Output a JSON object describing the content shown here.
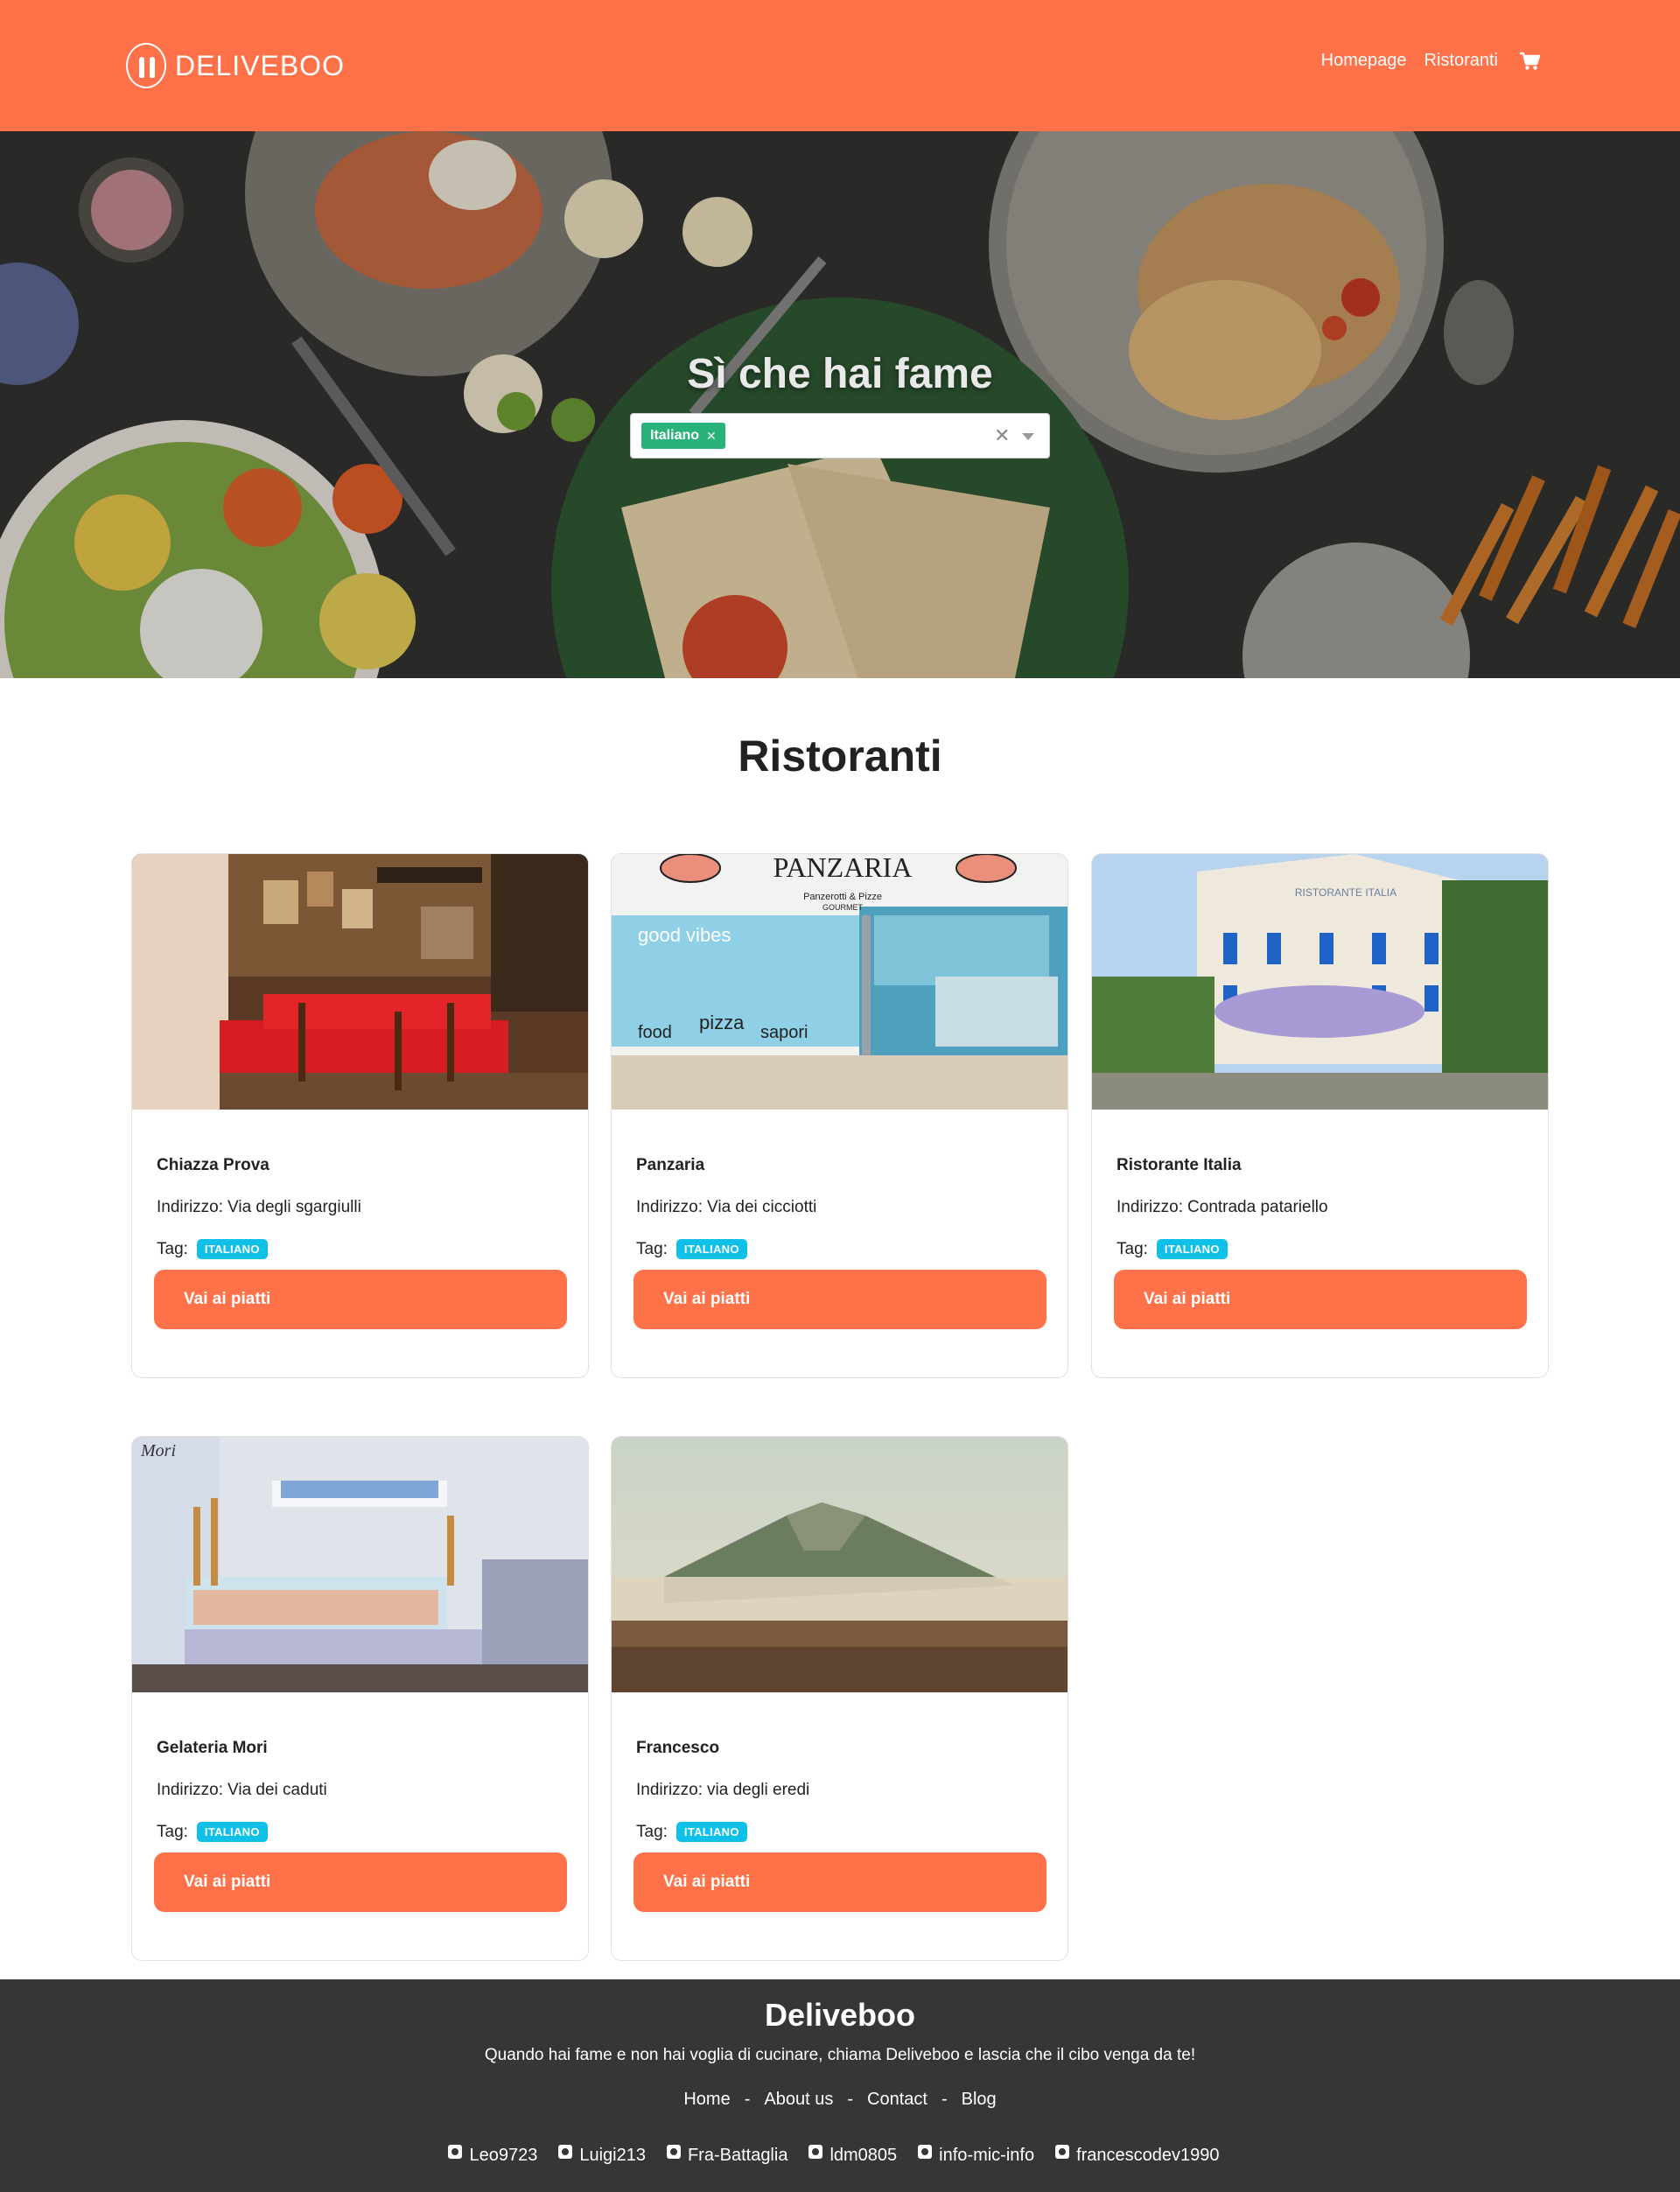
{
  "header": {
    "logo_text": "DELIVEBOO",
    "nav": [
      {
        "label": "Homepage"
      },
      {
        "label": "Ristoranti"
      }
    ]
  },
  "hero": {
    "title": "Sì che hai fame",
    "select": {
      "selected_chip": "Italiano"
    }
  },
  "section": {
    "title": "Ristoranti"
  },
  "cards": [
    {
      "name": "Chiazza Prova",
      "address_label": "Indirizzo:",
      "address": "Via degli sgargiulli",
      "tag_label": "Tag:",
      "tag": "ITALIANO",
      "button": "Vai ai piatti"
    },
    {
      "name": "Panzaria",
      "address_label": "Indirizzo:",
      "address": "Via dei cicciotti",
      "tag_label": "Tag:",
      "tag": "ITALIANO",
      "button": "Vai ai piatti"
    },
    {
      "name": "Ristorante Italia",
      "address_label": "Indirizzo:",
      "address": "Contrada patariello",
      "tag_label": "Tag:",
      "tag": "ITALIANO",
      "button": "Vai ai piatti"
    },
    {
      "name": "Gelateria Mori",
      "address_label": "Indirizzo:",
      "address": "Via dei caduti",
      "tag_label": "Tag:",
      "tag": "ITALIANO",
      "button": "Vai ai piatti"
    },
    {
      "name": "Francesco",
      "address_label": "Indirizzo:",
      "address": "via degli eredi",
      "tag_label": "Tag:",
      "tag": "ITALIANO",
      "button": "Vai ai piatti"
    }
  ],
  "card_images": {
    "panzaria_sign": "PANZARIA",
    "panzaria_sub": "Panzerotti & Pizze",
    "panzaria_gourmet": "GOURMET",
    "panzaria_words": [
      "good vibes",
      "pizza",
      "food",
      "sapori"
    ],
    "ristorante_sign": "RISTORANTE ITALIA",
    "gelateria_sign": "Mori"
  },
  "footer": {
    "title": "Deliveboo",
    "description": "Quando hai fame e non hai voglia di cucinare, chiama Deliveboo e lascia che il cibo venga da te!",
    "links": [
      "Home",
      "About us",
      "Contact",
      "Blog"
    ],
    "separator": "-",
    "users": [
      "Leo9723",
      "Luigi213",
      "Fra-Battaglia",
      "ldm0805",
      "info-mic-info",
      "francescodev1990"
    ]
  },
  "colors": {
    "brand": "#ff7149",
    "badge": "#0fc0e8",
    "chip": "#2ab27b",
    "footer_bg": "#363636"
  }
}
